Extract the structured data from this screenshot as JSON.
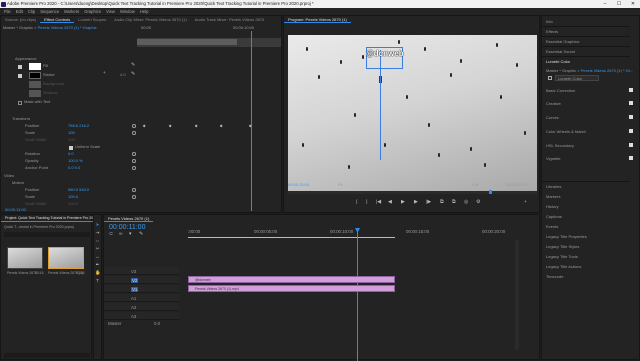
{
  "window": {
    "title": "Adobe Premiere Pro 2020 - C:\\Users\\duong\\Desktop\\Quick Text Tracking Tutorial in Premiere Pro 2020\\Quick Text Tracking Tutorial in Premiere Pro 2020.prproj *",
    "minimize": "–",
    "maximize": "☐",
    "close": "✕"
  },
  "menu": [
    "File",
    "Edit",
    "Clip",
    "Sequence",
    "Markers",
    "Graphics",
    "View",
    "Window",
    "Help"
  ],
  "top_tabs": [
    "Source: (no clips)",
    "Effect Controls",
    "Lumetri Scopes",
    "Audio Clip Mixer: Pexels Videos 2670 (1)",
    "Audio Track Mixer: Pexels Videos 2670"
  ],
  "effect_controls": {
    "header_master": "Master * Graphic",
    "header_clip": "Pexels Videos 2670 (1) * Graphic",
    "time_start": "00:00",
    "time_mark": "00:00:10:00",
    "props": [
      {
        "label": "Appearance",
        "value": ""
      },
      {
        "label": "Fill",
        "value": ""
      },
      {
        "label": "Stroke",
        "value": "4.0"
      },
      {
        "label": "Background",
        "value": ""
      },
      {
        "label": "Shadow",
        "value": ""
      },
      {
        "label": "Mask with Text",
        "value": ""
      },
      {
        "label": "Transform",
        "value": ""
      },
      {
        "label": "Position",
        "value": "758.6   216.2"
      },
      {
        "label": "Scale",
        "value": "100"
      },
      {
        "label": "Scale Width",
        "value": "100"
      },
      {
        "label": "Uniform Scale",
        "value": ""
      },
      {
        "label": "Rotation",
        "value": "0.0"
      },
      {
        "label": "Opacity",
        "value": "100.0 %"
      },
      {
        "label": "Anchor Point",
        "value": "0.0   0.0"
      },
      {
        "label": "Video",
        "value": ""
      },
      {
        "label": "Motion",
        "value": ""
      },
      {
        "label": "Position",
        "value": "960.0   540.0"
      },
      {
        "label": "Scale",
        "value": "100.0"
      },
      {
        "label": "Scale Width",
        "value": "100.0"
      }
    ],
    "timecode": "00:00:11:00"
  },
  "program": {
    "title": "Program: Pexels Videos 2670 (1)",
    "overlay_text": "@dcnweb",
    "timecode": "00:00:11:00",
    "fit": "Fit",
    "quality": "Full",
    "duration": "00:00:13:16",
    "controls": [
      "{",
      "}",
      "|◀",
      "◀|",
      "◀",
      "▶",
      "▶",
      "|▶",
      "⧉",
      "⧉",
      "◎",
      "⚙",
      "+"
    ]
  },
  "right_panel": {
    "items_top": [
      "Info",
      "Effects",
      "Essential Graphics",
      "Essential Sound",
      "Lumetri Color"
    ],
    "lumetri_master": "Master * Graphic",
    "lumetri_clip": "Pexels Videos 2670 (1) * Gr...",
    "lumetri_fx": "Lumetri Color",
    "lumetri_sections": [
      "Basic Correction",
      "Creative",
      "Curves",
      "Color Wheels & Match",
      "HSL Secondary",
      "Vignette"
    ],
    "items_bottom": [
      "Libraries",
      "Markers",
      "History",
      "Captions",
      "Events",
      "Legacy Title Properties",
      "Legacy Title Styles",
      "Legacy Title Tools",
      "Legacy Title Actions",
      "Timecode"
    ]
  },
  "project": {
    "tab": "Project: Quick Text Tracking Tutorial in Premiere Pro 2020",
    "path": "Quick T...ntorial in Premiere Pro 2020.prproj",
    "items": [
      {
        "name": "Pexels Videos 2670",
        "dur": "13:16"
      },
      {
        "name": "Pexels Videos 2670 (1)",
        "dur": "13:16"
      }
    ]
  },
  "timeline": {
    "tab": "Pexels Videos 2670 (1)",
    "timecode": "00:00:11:00",
    "ruler": [
      ":00:00",
      "00:00:05:00",
      "00:00:10:00",
      "00:00:15:00",
      "00:00:20:00"
    ],
    "tracks": [
      {
        "name": "V3",
        "label": "V3"
      },
      {
        "name": "V2",
        "label": "V2"
      },
      {
        "name": "V1",
        "label": "V1"
      },
      {
        "name": "A1",
        "label": "A1"
      },
      {
        "name": "A2",
        "label": "A2"
      },
      {
        "name": "A3",
        "label": "A3"
      }
    ],
    "master": "Master",
    "master_val": "0.0",
    "clips": [
      {
        "name": "@dcnweb",
        "track": 1
      },
      {
        "name": "Pexels Videos 2670 (1).mp4",
        "track": 2
      }
    ]
  },
  "colors": {
    "accent": "#2d8ceb",
    "clip": "#d19edb",
    "yellow": "#e2c23a"
  }
}
